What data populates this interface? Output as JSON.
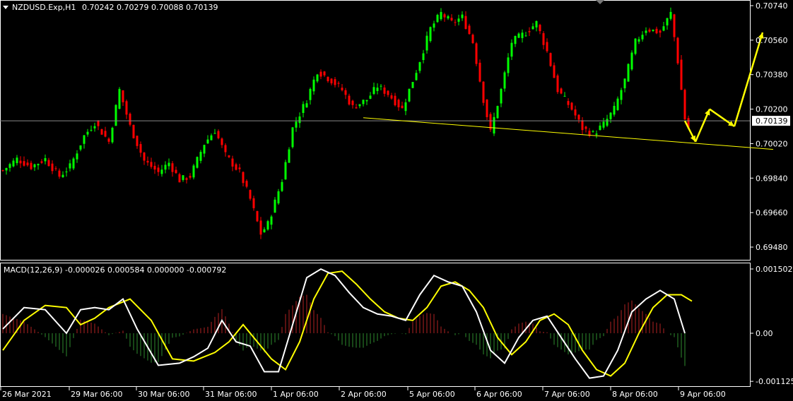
{
  "header": {
    "symbol": "NZDUSD.Exp,H1",
    "ohlc": "0.70242 0.70279 0.70088 0.70139"
  },
  "macd_header": "MACD(12,26,9) -0.000026 0.000584 0.000000 -0.000792",
  "current_price_label": "0.70139",
  "colors": {
    "background": "#000000",
    "bull_candle": "#00ff00",
    "bear_candle": "#ff0000",
    "trendline": "#ffff00",
    "macd_line": "#ffffff",
    "signal_line": "#ffff00",
    "hist_positive": "#b22222",
    "hist_negative": "#2e8b2e",
    "grid_border": "#ffffff"
  },
  "chart_data": [
    {
      "type": "candlestick",
      "title": "NZDUSD.Exp,H1",
      "y_ticks": [
        "0.70740",
        "0.70560",
        "0.70380",
        "0.70200",
        "0.70020",
        "0.69840",
        "0.69660",
        "0.69480"
      ],
      "ylim": [
        0.6946,
        0.7075
      ],
      "x_ticks": [
        "26 Mar 2021",
        "29 Mar 06:00",
        "30 Mar 06:00",
        "31 Mar 06:00",
        "1 Apr 06:00",
        "2 Apr 06:00",
        "5 Apr 06:00",
        "6 Apr 06:00",
        "7 Apr 06:00",
        "8 Apr 06:00",
        "9 Apr 06:00"
      ],
      "current_price": 0.70139,
      "close_path": [
        [
          0,
          0.6988
        ],
        [
          4,
          0.6994
        ],
        [
          8,
          0.699
        ],
        [
          12,
          0.6994
        ],
        [
          16,
          0.6985
        ],
        [
          19,
          0.699
        ],
        [
          23,
          0.7006
        ],
        [
          26,
          0.7013
        ],
        [
          30,
          0.7003
        ],
        [
          33,
          0.703
        ],
        [
          36,
          0.7011
        ],
        [
          40,
          0.6993
        ],
        [
          44,
          0.6987
        ],
        [
          47,
          0.6992
        ],
        [
          50,
          0.6983
        ],
        [
          53,
          0.6985
        ],
        [
          57,
          0.7002
        ],
        [
          60,
          0.7009
        ],
        [
          63,
          0.6996
        ],
        [
          67,
          0.6987
        ],
        [
          70,
          0.6973
        ],
        [
          73,
          0.6955
        ],
        [
          75,
          0.696
        ],
        [
          79,
          0.6983
        ],
        [
          82,
          0.701
        ],
        [
          86,
          0.7025
        ],
        [
          89,
          0.704
        ],
        [
          93,
          0.7035
        ],
        [
          96,
          0.703
        ],
        [
          99,
          0.7021
        ],
        [
          103,
          0.7025
        ],
        [
          106,
          0.7032
        ],
        [
          109,
          0.7028
        ],
        [
          113,
          0.702
        ],
        [
          117,
          0.704
        ],
        [
          121,
          0.7062
        ],
        [
          124,
          0.707
        ],
        [
          127,
          0.7065
        ],
        [
          130,
          0.7068
        ],
        [
          133,
          0.7055
        ],
        [
          136,
          0.7025
        ],
        [
          138,
          0.7008
        ],
        [
          141,
          0.703
        ],
        [
          144,
          0.7055
        ],
        [
          148,
          0.706
        ],
        [
          151,
          0.7065
        ],
        [
          154,
          0.705
        ],
        [
          157,
          0.703
        ],
        [
          161,
          0.702
        ],
        [
          164,
          0.701
        ],
        [
          167,
          0.7007
        ],
        [
          170,
          0.7012
        ],
        [
          173,
          0.702
        ],
        [
          176,
          0.7035
        ],
        [
          179,
          0.7055
        ],
        [
          182,
          0.7062
        ],
        [
          186,
          0.706
        ],
        [
          189,
          0.707
        ],
        [
          191,
          0.7045
        ],
        [
          193,
          0.7015
        ],
        [
          194,
          0.701
        ]
      ],
      "trendline": [
        [
          102,
          0.70155
        ],
        [
          218,
          0.6999
        ]
      ],
      "projection": [
        [
          193,
          0.70139
        ],
        [
          196,
          0.7003
        ],
        [
          200,
          0.702
        ],
        [
          207,
          0.7011
        ],
        [
          215,
          0.706
        ]
      ]
    },
    {
      "type": "macd",
      "title": "MACD(12,26,9)",
      "y_ticks": [
        "0.001502",
        "0.00",
        "-0.001125"
      ],
      "ylim": [
        -0.00118,
        0.00158
      ],
      "macd": [
        [
          0,
          0.0001
        ],
        [
          6,
          0.0006
        ],
        [
          12,
          0.00055
        ],
        [
          18,
          0.0
        ],
        [
          22,
          0.00055
        ],
        [
          26,
          0.0006
        ],
        [
          30,
          0.00055
        ],
        [
          34,
          0.0008
        ],
        [
          38,
          0.0001
        ],
        [
          44,
          -0.00075
        ],
        [
          50,
          -0.0007
        ],
        [
          54,
          -0.00055
        ],
        [
          58,
          -0.00035
        ],
        [
          62,
          0.0003
        ],
        [
          66,
          -0.0002
        ],
        [
          70,
          -0.0003
        ],
        [
          74,
          -0.0009
        ],
        [
          78,
          -0.0009
        ],
        [
          82,
          0.0002
        ],
        [
          86,
          0.0013
        ],
        [
          90,
          0.0015
        ],
        [
          94,
          0.00135
        ],
        [
          98,
          0.00095
        ],
        [
          102,
          0.0006
        ],
        [
          106,
          0.00045
        ],
        [
          110,
          0.0004
        ],
        [
          114,
          0.0003
        ],
        [
          118,
          0.0009
        ],
        [
          122,
          0.00135
        ],
        [
          126,
          0.0012
        ],
        [
          130,
          0.0011
        ],
        [
          134,
          0.0005
        ],
        [
          138,
          -0.0004
        ],
        [
          142,
          -0.0007
        ],
        [
          146,
          -0.0001
        ],
        [
          150,
          0.0003
        ],
        [
          154,
          0.0004
        ],
        [
          158,
          -0.0001
        ],
        [
          162,
          -0.0006
        ],
        [
          166,
          -0.00105
        ],
        [
          170,
          -0.001
        ],
        [
          174,
          -0.0004
        ],
        [
          178,
          0.0005
        ],
        [
          182,
          0.0008
        ],
        [
          186,
          0.001
        ],
        [
          190,
          0.0008
        ],
        [
          193,
          0.0
        ]
      ],
      "signal": [
        [
          0,
          -0.0004
        ],
        [
          6,
          0.0003
        ],
        [
          12,
          0.00065
        ],
        [
          18,
          0.0006
        ],
        [
          22,
          0.0002
        ],
        [
          26,
          0.00035
        ],
        [
          30,
          0.0006
        ],
        [
          36,
          0.0008
        ],
        [
          42,
          0.0003
        ],
        [
          48,
          -0.0006
        ],
        [
          54,
          -0.00065
        ],
        [
          60,
          -0.00045
        ],
        [
          64,
          -0.0002
        ],
        [
          68,
          0.0002
        ],
        [
          72,
          -0.0002
        ],
        [
          76,
          -0.0006
        ],
        [
          80,
          -0.00085
        ],
        [
          84,
          -0.0002
        ],
        [
          88,
          0.0008
        ],
        [
          92,
          0.0014
        ],
        [
          96,
          0.00145
        ],
        [
          100,
          0.00115
        ],
        [
          104,
          0.0008
        ],
        [
          108,
          0.0005
        ],
        [
          112,
          0.00035
        ],
        [
          116,
          0.0003
        ],
        [
          120,
          0.0006
        ],
        [
          124,
          0.0011
        ],
        [
          128,
          0.0012
        ],
        [
          132,
          0.001
        ],
        [
          136,
          0.0006
        ],
        [
          140,
          -0.0001
        ],
        [
          144,
          -0.0005
        ],
        [
          148,
          -0.0002
        ],
        [
          152,
          0.0003
        ],
        [
          156,
          0.00045
        ],
        [
          160,
          0.0002
        ],
        [
          164,
          -0.0004
        ],
        [
          168,
          -0.00085
        ],
        [
          172,
          -0.001
        ],
        [
          176,
          -0.0007
        ],
        [
          180,
          0.0
        ],
        [
          184,
          0.0006
        ],
        [
          188,
          0.0009
        ],
        [
          192,
          0.0009
        ],
        [
          195,
          0.00075
        ]
      ]
    }
  ]
}
